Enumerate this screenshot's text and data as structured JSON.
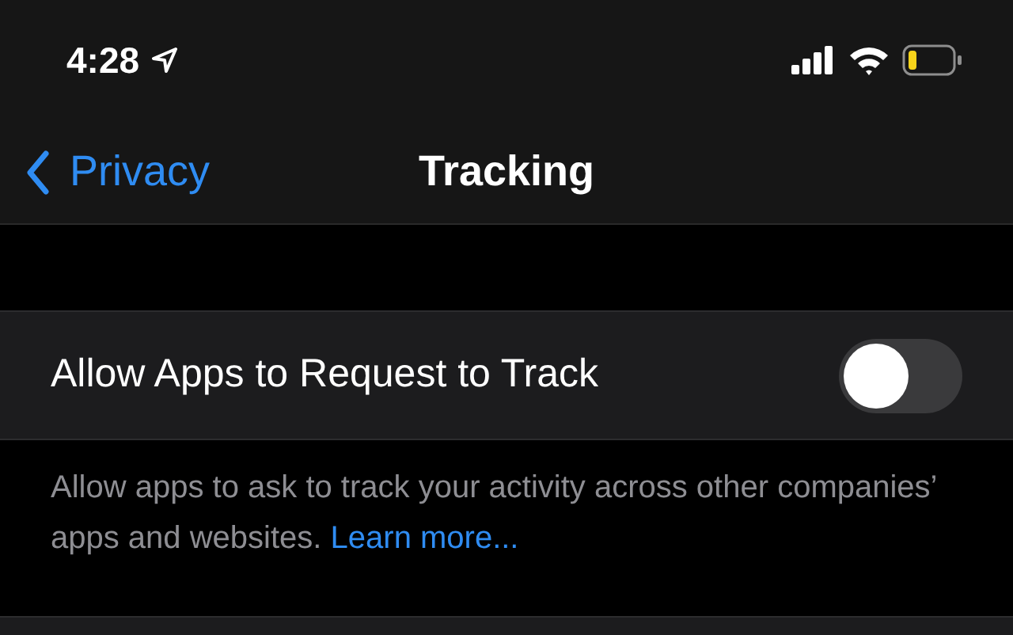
{
  "status_bar": {
    "time": "4:28"
  },
  "nav_bar": {
    "back": "Privacy",
    "title": "Tracking"
  },
  "setting": {
    "label": "Allow Apps to Request to Track",
    "on": false
  },
  "footer": {
    "text": "Allow apps to ask to track your activity across other companies’ apps and websites.",
    "link": "Learn more..."
  }
}
